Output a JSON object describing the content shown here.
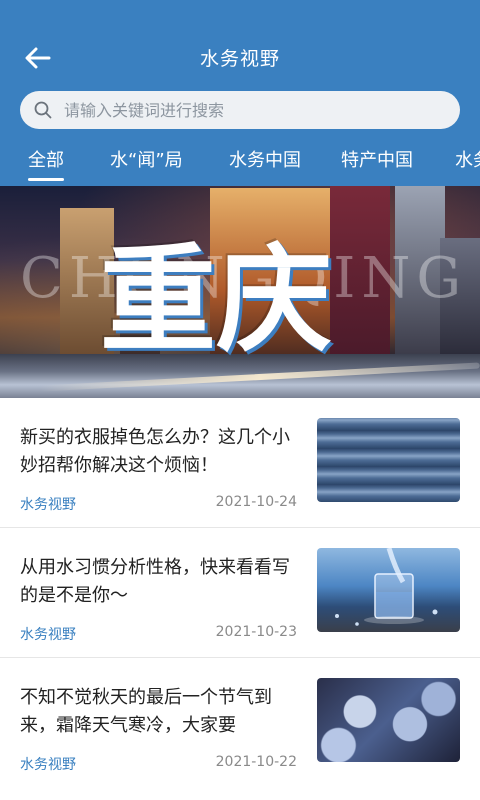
{
  "header": {
    "back_icon": "arrow-left-icon",
    "title": "水务视野"
  },
  "search": {
    "placeholder": "请输入关键词进行搜索",
    "icon": "search-icon"
  },
  "tabs": [
    {
      "label": "全部",
      "active": true
    },
    {
      "label": "水“闻”局",
      "active": false
    },
    {
      "label": "水务中国",
      "active": false
    },
    {
      "label": "特产中国",
      "active": false
    },
    {
      "label": "水务",
      "active": false
    }
  ],
  "banner": {
    "title": "重庆",
    "bg_word": "CHONGQING"
  },
  "news": [
    {
      "title": "新买的衣服掉色怎么办？这几个小妙招帮你解决这个烦恼！",
      "source": "水务视野",
      "date": "2021-10-24",
      "thumb": "jeans-image"
    },
    {
      "title": "从用水习惯分析性格，快来看看写的是不是你～",
      "source": "水务视野",
      "date": "2021-10-23",
      "thumb": "water-glass-image"
    },
    {
      "title": "不知不觉秋天的最后一个节气到来，霜降天气寒冷，大家要",
      "source": "水务视野",
      "date": "2021-10-22",
      "thumb": "frost-leaves-image"
    }
  ],
  "colors": {
    "primary": "#3a80c0",
    "search_bg": "#eef1f4",
    "date_gray": "#8a8a8a"
  }
}
